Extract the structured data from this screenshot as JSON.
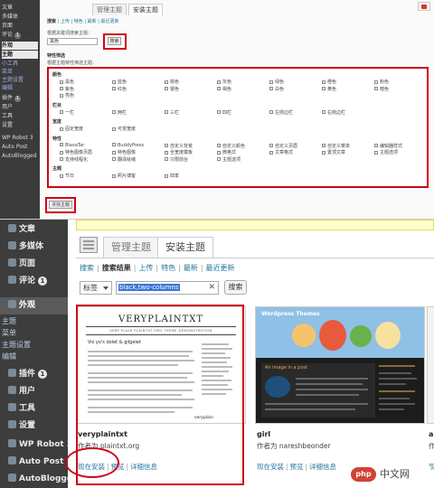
{
  "top": {
    "sidebar": [
      "文章",
      "多媒体",
      "页面",
      "评论",
      "外观",
      "主题",
      "小工具",
      "菜单",
      "主题设置",
      "编辑",
      "插件",
      "用户",
      "工具",
      "设置",
      "WP Robot 3",
      "Auto Post",
      "AutoBlogged"
    ],
    "comment_count": "1",
    "plugin_count": "1",
    "tabs": [
      "管理主题",
      "安装主题"
    ],
    "sublinks": [
      "搜索",
      "上传",
      "特色",
      "最新",
      "最近更新"
    ],
    "search_hint": "根据关键词搜索主题：",
    "search_value": "黑色",
    "search_button": "搜索",
    "filter_title": "特性筛选",
    "filter_hint": "根据主题特性筛选主题：",
    "groups": [
      {
        "name": "颜色",
        "items": [
          "黑色",
          "蓝色",
          "棕色",
          "灰色",
          "绿色",
          "橙色",
          "粉色",
          "紫色",
          "红色",
          "银色",
          "褐色",
          "白色",
          "黄色",
          "暗色",
          "亮色"
        ]
      },
      {
        "name": "栏目",
        "items": [
          "一栏",
          "两栏",
          "三栏",
          "四栏",
          "左侧边栏",
          "右侧边栏"
        ]
      },
      {
        "name": "宽度",
        "items": [
          "固定宽度",
          "可变宽度"
        ]
      },
      {
        "name": "特性",
        "items": [
          "BlavaTar",
          "BuddyPress",
          "自定义背景",
          "自定义颜色",
          "自定义页眉",
          "自定义菜单",
          "编辑器样式",
          "特色图像页眉",
          "特色图像",
          "全宽度模板",
          "微格式",
          "文章格式",
          "置顶文章",
          "主题选项",
          "支持线程化",
          "翻译就绪",
          "只限前台",
          "主题选项"
        ]
      },
      {
        "name": "主题",
        "items": [
          "节日",
          "照片博客",
          "四季"
        ]
      }
    ],
    "find_button": "寻找主题"
  },
  "bottom": {
    "sidebar": [
      {
        "label": "文章"
      },
      {
        "label": "多媒体"
      },
      {
        "label": "页面"
      },
      {
        "label": "评论",
        "badge": "1"
      },
      {
        "label": "外观"
      },
      {
        "label": "主题"
      },
      {
        "label": "菜单"
      },
      {
        "label": "主题设置"
      },
      {
        "label": "编辑"
      },
      {
        "label": "插件",
        "badge": "1"
      },
      {
        "label": "用户"
      },
      {
        "label": "工具"
      },
      {
        "label": "设置"
      },
      {
        "label": "WP Robot 3"
      },
      {
        "label": "Auto Post"
      },
      {
        "label": "AutoBlogged"
      }
    ],
    "tabs": [
      "管理主题",
      "安装主题"
    ],
    "links": [
      "搜索",
      "搜索结果",
      "上传",
      "特色",
      "最新",
      "最近更新"
    ],
    "search_type": "标签",
    "search_value": "black,two-columns",
    "search_button": "搜索",
    "themes": [
      {
        "name": "veryplaintxt",
        "author_prefix": "作者为 ",
        "author": "plaintxt.org",
        "actions": [
          "现在安装",
          "预览",
          "详细信息"
        ],
        "thumb_title": "VERYPLAINTXT",
        "thumb_tagline": "VERY PLAIN PLAINTXT.ORG THEME DEMONSTRATION",
        "thumb_post": "Vis yo's dolet & gilgelet",
        "thumb_bottom": "veryplain"
      },
      {
        "name": "girl",
        "author_prefix": "作者为 ",
        "author": "nareshbeonder",
        "actions": [
          "现在安装",
          "预览",
          "详细信息"
        ],
        "thumb_title": "Wordpress Themes",
        "thumb_post": "An image in a post"
      },
      {
        "name": "al",
        "author_prefix": "作",
        "author": "",
        "actions": [
          "现"
        ]
      }
    ]
  },
  "watermark": {
    "logo": "php",
    "text": "中文网"
  },
  "colors": {
    "highlight": "#d0021b",
    "link": "#21759b",
    "sidebar": "#3d3d3d"
  }
}
